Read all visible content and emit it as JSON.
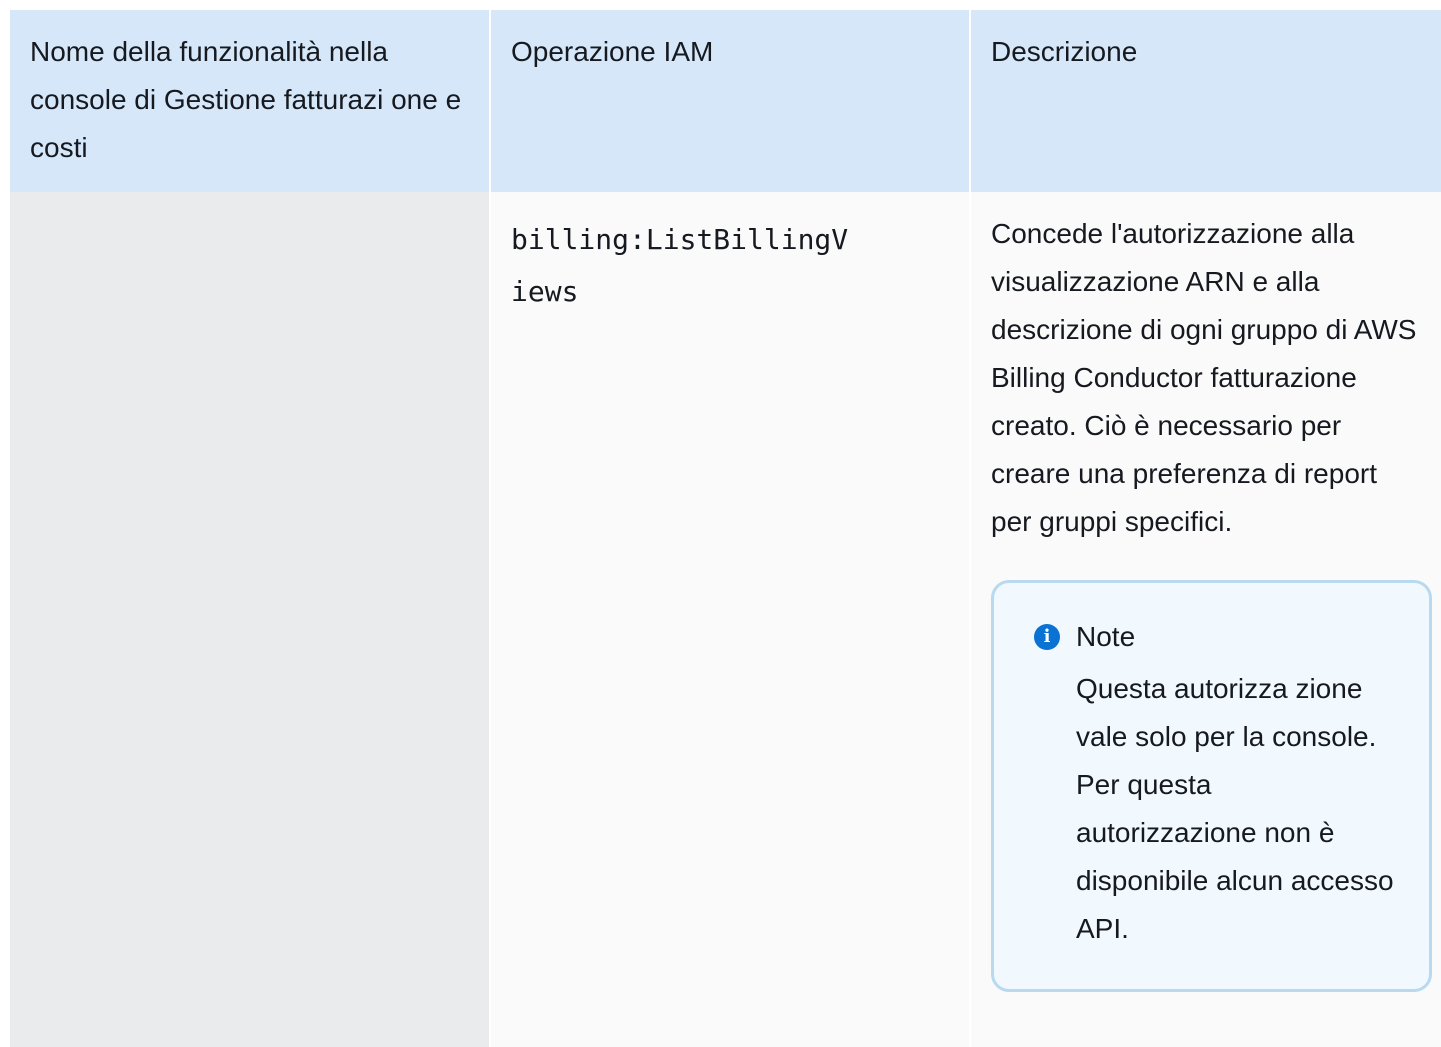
{
  "table": {
    "headers": [
      "Nome della funzionalità nella console di Gestione fatturazi one e costi",
      "Operazione IAM",
      "Descrizione"
    ],
    "rows": [
      {
        "feature": "",
        "action": "billing:ListBillingViews",
        "description": "Concede l'autorizzazione alla visualizzazione ARN e alla descrizione di ogni gruppo di AWS Billing Conductor fatturazione creato. Ciò è necessario per creare una preferenza di report per gruppi specifici.",
        "note": {
          "icon": "info-icon",
          "title": "Note",
          "body": "Questa autorizza zione vale solo per la console. Per questa autorizzazione non è disponibile alcun accesso API."
        }
      }
    ]
  },
  "colors": {
    "header_bg": "#d5e7f8",
    "feature_cell_bg": "#e9ebed",
    "cell_bg": "#fafafa",
    "note_bg": "#f1f8fe",
    "note_border": "#b8d9f0",
    "info_icon": "#0972d3",
    "text": "#16191f"
  }
}
